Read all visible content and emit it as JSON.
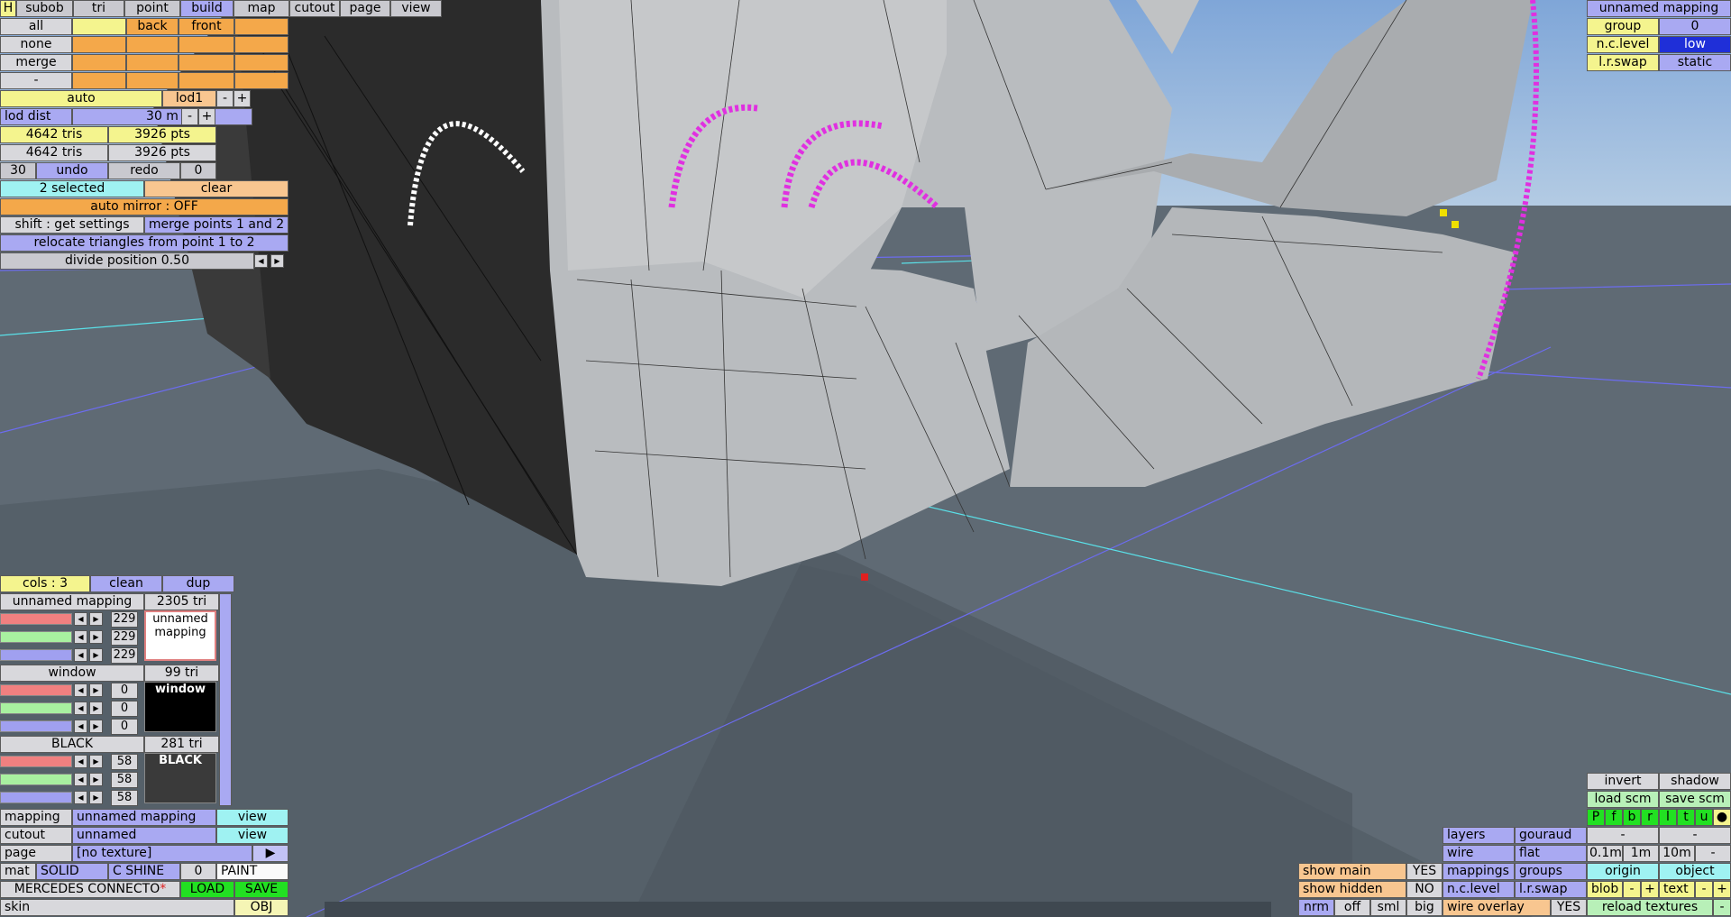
{
  "top_menu": {
    "h": "H",
    "tabs": [
      "subob",
      "tri",
      "point",
      "build",
      "map",
      "cutout",
      "page",
      "view"
    ]
  },
  "select_grid": {
    "all": "all",
    "none": "none",
    "merge": "merge",
    "dash": "-",
    "back": "back",
    "front": "front"
  },
  "lod": {
    "auto": "auto",
    "lod1": "lod1",
    "minus": "-",
    "plus": "+",
    "dist_label": "lod dist",
    "dist_value": "30 m"
  },
  "stats": {
    "tris1": "4642 tris",
    "pts1": "3926 pts",
    "tris2": "4642 tris",
    "pts2": "3926 pts"
  },
  "undo_row": {
    "count": "30",
    "undo": "undo",
    "redo": "redo",
    "redo_count": "0"
  },
  "selection": {
    "selected": "2 selected",
    "clear": "clear",
    "auto_mirror": "auto mirror : OFF",
    "shift_settings": "shift : get settings",
    "merge_points": "merge points 1 and 2",
    "relocate": "relocate triangles from point 1 to 2",
    "divide": "divide position 0.50"
  },
  "mapping_panel": {
    "cols": "cols : 3",
    "clean": "clean",
    "dup": "dup",
    "items": [
      {
        "name": "unnamed mapping",
        "tri": "2305 tri",
        "r": "229",
        "g": "229",
        "b": "229",
        "preview": "unnamed mapping",
        "preview_bg": "#ffffff",
        "preview_fg": "#000000",
        "selected": true
      },
      {
        "name": "window",
        "tri": "99 tri",
        "r": "0",
        "g": "0",
        "b": "0",
        "preview": "window",
        "preview_bg": "#000000",
        "preview_fg": "#ffffff",
        "selected": false
      },
      {
        "name": "BLACK",
        "tri": "281 tri",
        "r": "58",
        "g": "58",
        "b": "58",
        "preview": "BLACK",
        "preview_bg": "#3a3a3a",
        "preview_fg": "#ffffff",
        "selected": false
      }
    ]
  },
  "bottom_left": {
    "mapping_label": "mapping",
    "mapping_value": "unnamed mapping",
    "mapping_view": "view",
    "cutout_label": "cutout",
    "cutout_value": "unnamed",
    "cutout_view": "view",
    "page_label": "page",
    "page_value": "[no texture]",
    "mat": "mat",
    "solid": "SOLID",
    "cshine": "C SHINE",
    "shine_val": "0",
    "paint": "PAINT",
    "model_name": "MERCEDES CONNECTO",
    "modified_mark": "*",
    "load": "LOAD",
    "save": "SAVE",
    "skin": "skin",
    "obj": "OBJ"
  },
  "top_right": {
    "title": "unnamed mapping",
    "group_label": "group",
    "group_value": "0",
    "nclevel_label": "n.c.level",
    "nclevel_value": "low",
    "lrswap_label": "l.r.swap",
    "lrswap_value": "static"
  },
  "bottom_right": {
    "invert": "invert",
    "shadow": "shadow",
    "load_scm": "load scm",
    "save_scm": "save scm",
    "letters": [
      "P",
      "f",
      "b",
      "r",
      "l",
      "t",
      "u",
      "●"
    ],
    "dash1": "-",
    "dash2": "-",
    "layers": "layers",
    "gouraud": "gouraud",
    "wire": "wire",
    "flat": "flat",
    "mappings": "mappings",
    "groups": "groups",
    "nclevel": "n.c.level",
    "lrswap": "l.r.swap",
    "scale1": "0.1m",
    "scale2": "1m",
    "scale3": "10m",
    "scale_minus": "-",
    "origin": "origin",
    "object": "object",
    "blob": "blob",
    "text": "text",
    "minus": "-",
    "plus": "+",
    "show_main": "show main",
    "show_main_val": "YES",
    "show_hidden": "show hidden",
    "show_hidden_val": "NO",
    "nrm": "nrm",
    "off": "off",
    "sml": "sml",
    "big": "big",
    "wire_overlay": "wire overlay",
    "wire_overlay_val": "YES",
    "reload": "reload textures"
  },
  "colors": {
    "sky": "#8fb2dc",
    "ground": "#5f6a74",
    "accent_magenta": "#e030e0",
    "select_yellow": "#f0e000"
  }
}
